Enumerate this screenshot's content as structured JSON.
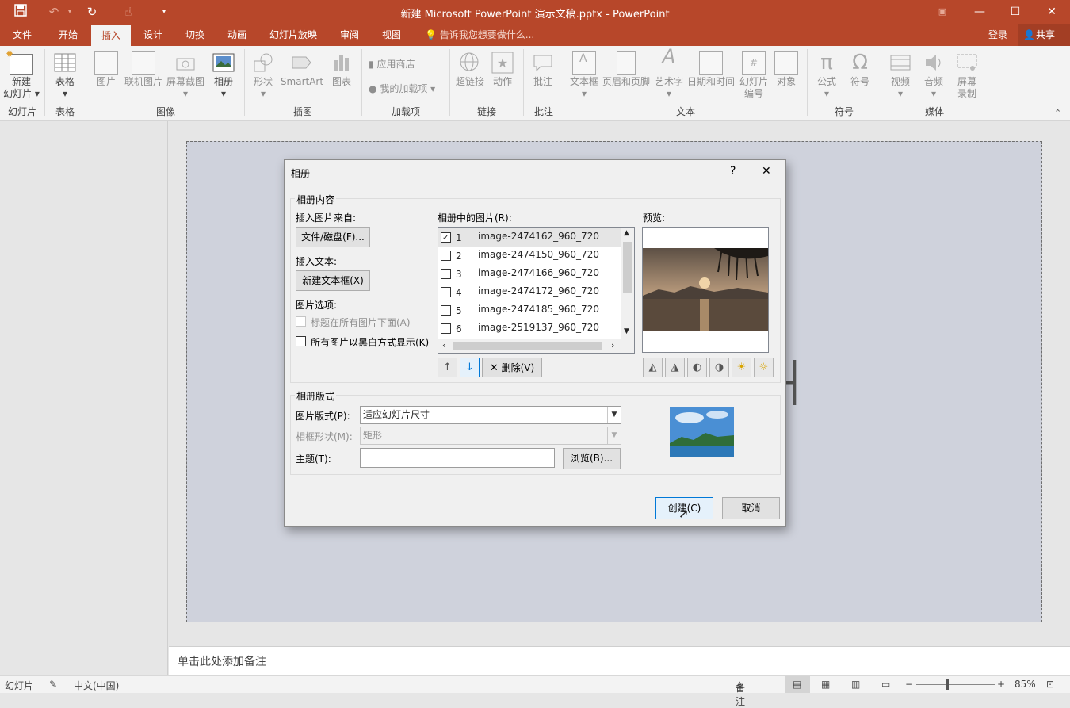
{
  "app": {
    "title": "新建 Microsoft PowerPoint 演示文稿.pptx - PowerPoint",
    "quick_access": [
      "save-icon",
      "undo-icon",
      "redo-icon",
      "touch-mode-icon",
      "customize-icon"
    ]
  },
  "tabs": [
    "文件",
    "开始",
    "插入",
    "设计",
    "切换",
    "动画",
    "幻灯片放映",
    "审阅",
    "视图"
  ],
  "active_tab": "插入",
  "tell_me": "告诉我您想要做什么...",
  "account": {
    "login": "登录",
    "share": "共享"
  },
  "ribbon": {
    "new_slide": {
      "line1": "新建",
      "line2": "幻灯片"
    },
    "table": "表格",
    "picture": "图片",
    "online_picture": "联机图片",
    "screenshot": "屏幕截图",
    "photo_album": "相册",
    "shapes": "形状",
    "smartart": "SmartArt",
    "chart": "图表",
    "store": "应用商店",
    "my_addins": "我的加载项",
    "hyperlink": "超链接",
    "action": "动作",
    "comment": "批注",
    "textbox": "文本框",
    "header_footer": "页眉和页脚",
    "wordart": "艺术字",
    "datetime": "日期和时间",
    "slide_number": {
      "line1": "幻灯片",
      "line2": "编号"
    },
    "object": "对象",
    "equation": "公式",
    "symbol": "符号",
    "video": "视频",
    "audio": "音频",
    "screen_recording": {
      "line1": "屏幕",
      "line2": "录制"
    },
    "groups": {
      "slides": "幻灯片",
      "tables": "表格",
      "images": "图像",
      "illustrations": "插图",
      "addins": "加载项",
      "links": "链接",
      "comments": "批注",
      "text": "文本",
      "symbols": "符号",
      "media": "媒体"
    }
  },
  "notes_placeholder": "单击此处添加备注",
  "status": {
    "slide": "幻灯片",
    "language": "中文(中国)",
    "notes": "备注",
    "zoom": "85%"
  },
  "dialog": {
    "title": "相册",
    "help": "?",
    "close": "✕",
    "album_content": "相册内容",
    "insert_from": "插入图片来自:",
    "file_disk": "文件/磁盘(F)...",
    "insert_text": "插入文本:",
    "new_textbox": "新建文本框(X)",
    "picture_options": "图片选项:",
    "captions_below": "标题在所有图片下面(A)",
    "all_bw": "所有图片以黑白方式显示(K)",
    "pictures_in_album": "相册中的图片(R):",
    "pictures": [
      {
        "num": "1",
        "name": "image-2474162_960_720",
        "checked": true
      },
      {
        "num": "2",
        "name": "image-2474150_960_720",
        "checked": false
      },
      {
        "num": "3",
        "name": "image-2474166_960_720",
        "checked": false
      },
      {
        "num": "4",
        "name": "image-2474172_960_720",
        "checked": false
      },
      {
        "num": "5",
        "name": "image-2474185_960_720",
        "checked": false
      },
      {
        "num": "6",
        "name": "image-2519137_960_720",
        "checked": false
      }
    ],
    "remove": "删除(V)",
    "preview": "预览:",
    "album_layout": "相册版式",
    "picture_layout_label": "图片版式(P):",
    "picture_layout_value": "适应幻灯片尺寸",
    "frame_shape_label": "相框形状(M):",
    "frame_shape_value": "矩形",
    "theme_label": "主题(T):",
    "theme_value": "",
    "browse": "浏览(B)...",
    "create": "创建(C)",
    "cancel": "取消"
  },
  "colors": {
    "accent": "#b7472a",
    "focus": "#0078d7"
  }
}
